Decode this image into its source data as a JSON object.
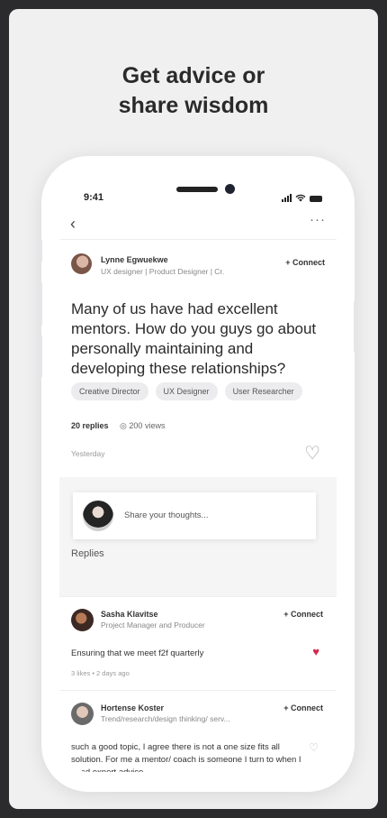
{
  "headline": {
    "line1": "Get advice or",
    "line2": "share wisdom"
  },
  "status_bar": {
    "time": "9:41"
  },
  "post": {
    "author": {
      "name": "Lynne Egwuekwe",
      "role": "UX designer | Product Designer | Cr."
    },
    "connect_label": "+ Connect",
    "question": "Many of us have had excellent mentors. How do you guys go about personally maintaining and developing these relationships?",
    "tags": [
      "Creative Director",
      "UX Designer",
      "User Researcher"
    ],
    "replies_count": "20 replies",
    "views": "200 views",
    "date": "Yesterday"
  },
  "compose": {
    "placeholder": "Share your thoughts..."
  },
  "replies_label": "Replies",
  "replies": [
    {
      "name": "Sasha Klavitse",
      "role": "Project Manager and Producer",
      "connect_label": "+ Connect",
      "text": "Ensuring that we meet f2f quarterly",
      "meta": "3 likes  •  2 days ago",
      "liked": true
    },
    {
      "name": "Hortense Koster",
      "role": "Trend/research/design thinking/ serv...",
      "connect_label": "+ Connect",
      "text": "such a good topic, I agree there is not a one size fits all solution. For me a mentor/ coach is someone I turn to when I need expert advice.",
      "liked": false
    }
  ],
  "colors": {
    "accent_heart": "#d8264a",
    "background": "#2b2b2e"
  }
}
